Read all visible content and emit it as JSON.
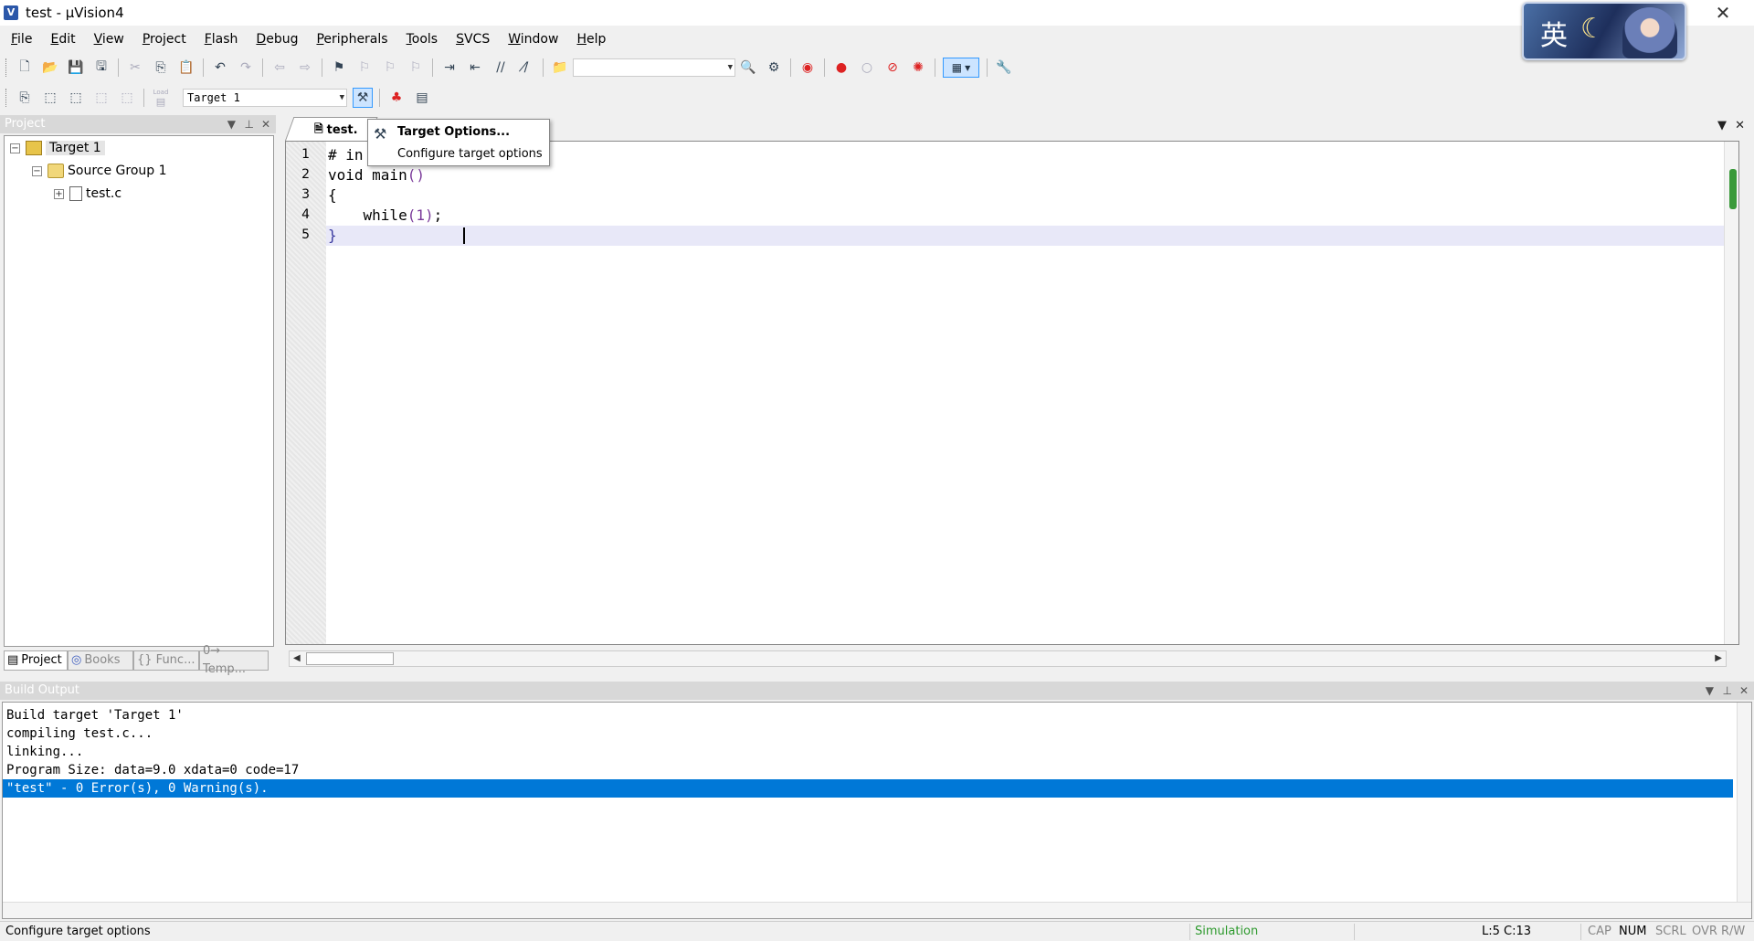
{
  "window": {
    "title": "test  - µVision4",
    "app_icon_letter": "V",
    "close_glyph": "✕",
    "ime_char": "英"
  },
  "menu": [
    {
      "label": "File",
      "key": "F",
      "rest": "ile"
    },
    {
      "label": "Edit",
      "key": "E",
      "rest": "dit"
    },
    {
      "label": "View",
      "key": "V",
      "rest": "iew"
    },
    {
      "label": "Project",
      "key": "P",
      "rest": "roject"
    },
    {
      "label": "Flash",
      "key": "F",
      "rest": "lash"
    },
    {
      "label": "Debug",
      "key": "D",
      "rest": "ebug"
    },
    {
      "label": "Peripherals",
      "key": "P",
      "rest": "eripherals"
    },
    {
      "label": "Tools",
      "key": "T",
      "rest": "ools"
    },
    {
      "label": "SVCS",
      "key": "S",
      "rest": "VCS"
    },
    {
      "label": "Window",
      "key": "W",
      "rest": "indow"
    },
    {
      "label": "Help",
      "key": "H",
      "rest": "elp"
    }
  ],
  "toolbar": {
    "find_combo_value": "",
    "target_combo_value": "Target 1",
    "load_label": "Load"
  },
  "project_panel": {
    "title": "Project",
    "tree": {
      "target": "Target 1",
      "group": "Source Group 1",
      "file": "test.c"
    },
    "tabs": [
      "Project",
      "Books",
      "{} Func...",
      "0→ Temp..."
    ]
  },
  "editor": {
    "tab_label": "test.",
    "lines": [
      {
        "no": "1",
        "text": "# in"
      },
      {
        "no": "2",
        "text": "void main()"
      },
      {
        "no": "3",
        "text": "{"
      },
      {
        "no": "4",
        "text": "    while(1);"
      },
      {
        "no": "5",
        "text": "}"
      }
    ]
  },
  "tooltip": {
    "title": "Target Options...",
    "description": "Configure target options"
  },
  "build_output": {
    "title": "Build Output",
    "lines": [
      "Build target 'Target 1'",
      "compiling test.c...",
      "linking...",
      "Program Size: data=9.0 xdata=0 code=17",
      "\"test\" - 0 Error(s), 0 Warning(s)."
    ],
    "selected_line": 5
  },
  "status_bar": {
    "message": "Configure target options",
    "mode": "Simulation",
    "mode_color": "#2e9a2e",
    "position": "L:5 C:13",
    "cap": "CAP",
    "num": "NUM",
    "scrl": "SCRL",
    "ovr": "OVR",
    "rw": "R/W"
  },
  "colors": {
    "selection": "#0078d7",
    "current_line": "#e8e8f8",
    "panel_header": "#d8d8d8"
  }
}
